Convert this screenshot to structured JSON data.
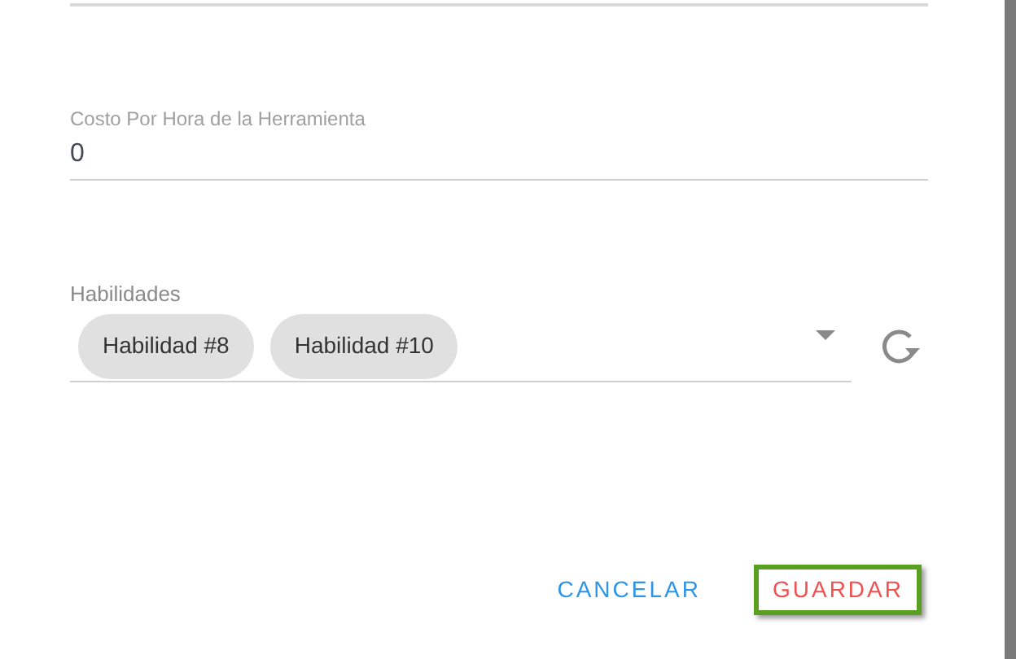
{
  "cost_field": {
    "label": "Costo Por Hora de la Herramienta",
    "value": "0"
  },
  "skills_field": {
    "label": "Habilidades",
    "chips": [
      "Habilidad #8",
      "Habilidad #10"
    ]
  },
  "buttons": [
    {
      "label": "CANCELAR",
      "kind": "cancel",
      "highlighted": false
    },
    {
      "label": "GUARDAR",
      "kind": "save",
      "highlighted": true
    }
  ]
}
